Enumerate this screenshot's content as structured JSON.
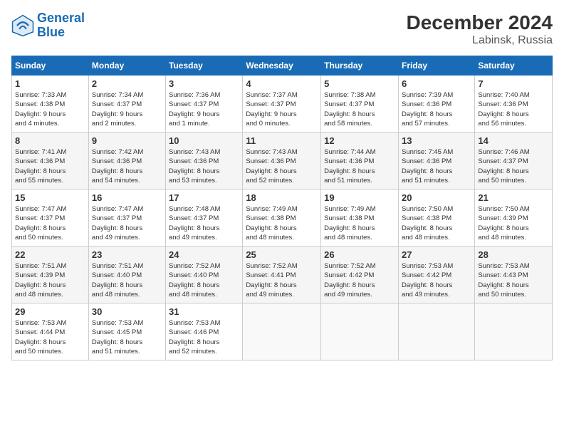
{
  "header": {
    "logo_line1": "General",
    "logo_line2": "Blue",
    "title": "December 2024",
    "subtitle": "Labinsk, Russia"
  },
  "days_of_week": [
    "Sunday",
    "Monday",
    "Tuesday",
    "Wednesday",
    "Thursday",
    "Friday",
    "Saturday"
  ],
  "weeks": [
    [
      {
        "day": "1",
        "info": "Sunrise: 7:33 AM\nSunset: 4:38 PM\nDaylight: 9 hours\nand 4 minutes."
      },
      {
        "day": "2",
        "info": "Sunrise: 7:34 AM\nSunset: 4:37 PM\nDaylight: 9 hours\nand 2 minutes."
      },
      {
        "day": "3",
        "info": "Sunrise: 7:36 AM\nSunset: 4:37 PM\nDaylight: 9 hours\nand 1 minute."
      },
      {
        "day": "4",
        "info": "Sunrise: 7:37 AM\nSunset: 4:37 PM\nDaylight: 9 hours\nand 0 minutes."
      },
      {
        "day": "5",
        "info": "Sunrise: 7:38 AM\nSunset: 4:37 PM\nDaylight: 8 hours\nand 58 minutes."
      },
      {
        "day": "6",
        "info": "Sunrise: 7:39 AM\nSunset: 4:36 PM\nDaylight: 8 hours\nand 57 minutes."
      },
      {
        "day": "7",
        "info": "Sunrise: 7:40 AM\nSunset: 4:36 PM\nDaylight: 8 hours\nand 56 minutes."
      }
    ],
    [
      {
        "day": "8",
        "info": "Sunrise: 7:41 AM\nSunset: 4:36 PM\nDaylight: 8 hours\nand 55 minutes."
      },
      {
        "day": "9",
        "info": "Sunrise: 7:42 AM\nSunset: 4:36 PM\nDaylight: 8 hours\nand 54 minutes."
      },
      {
        "day": "10",
        "info": "Sunrise: 7:43 AM\nSunset: 4:36 PM\nDaylight: 8 hours\nand 53 minutes."
      },
      {
        "day": "11",
        "info": "Sunrise: 7:43 AM\nSunset: 4:36 PM\nDaylight: 8 hours\nand 52 minutes."
      },
      {
        "day": "12",
        "info": "Sunrise: 7:44 AM\nSunset: 4:36 PM\nDaylight: 8 hours\nand 51 minutes."
      },
      {
        "day": "13",
        "info": "Sunrise: 7:45 AM\nSunset: 4:36 PM\nDaylight: 8 hours\nand 51 minutes."
      },
      {
        "day": "14",
        "info": "Sunrise: 7:46 AM\nSunset: 4:37 PM\nDaylight: 8 hours\nand 50 minutes."
      }
    ],
    [
      {
        "day": "15",
        "info": "Sunrise: 7:47 AM\nSunset: 4:37 PM\nDaylight: 8 hours\nand 50 minutes."
      },
      {
        "day": "16",
        "info": "Sunrise: 7:47 AM\nSunset: 4:37 PM\nDaylight: 8 hours\nand 49 minutes."
      },
      {
        "day": "17",
        "info": "Sunrise: 7:48 AM\nSunset: 4:37 PM\nDaylight: 8 hours\nand 49 minutes."
      },
      {
        "day": "18",
        "info": "Sunrise: 7:49 AM\nSunset: 4:38 PM\nDaylight: 8 hours\nand 48 minutes."
      },
      {
        "day": "19",
        "info": "Sunrise: 7:49 AM\nSunset: 4:38 PM\nDaylight: 8 hours\nand 48 minutes."
      },
      {
        "day": "20",
        "info": "Sunrise: 7:50 AM\nSunset: 4:38 PM\nDaylight: 8 hours\nand 48 minutes."
      },
      {
        "day": "21",
        "info": "Sunrise: 7:50 AM\nSunset: 4:39 PM\nDaylight: 8 hours\nand 48 minutes."
      }
    ],
    [
      {
        "day": "22",
        "info": "Sunrise: 7:51 AM\nSunset: 4:39 PM\nDaylight: 8 hours\nand 48 minutes."
      },
      {
        "day": "23",
        "info": "Sunrise: 7:51 AM\nSunset: 4:40 PM\nDaylight: 8 hours\nand 48 minutes."
      },
      {
        "day": "24",
        "info": "Sunrise: 7:52 AM\nSunset: 4:40 PM\nDaylight: 8 hours\nand 48 minutes."
      },
      {
        "day": "25",
        "info": "Sunrise: 7:52 AM\nSunset: 4:41 PM\nDaylight: 8 hours\nand 49 minutes."
      },
      {
        "day": "26",
        "info": "Sunrise: 7:52 AM\nSunset: 4:42 PM\nDaylight: 8 hours\nand 49 minutes."
      },
      {
        "day": "27",
        "info": "Sunrise: 7:53 AM\nSunset: 4:42 PM\nDaylight: 8 hours\nand 49 minutes."
      },
      {
        "day": "28",
        "info": "Sunrise: 7:53 AM\nSunset: 4:43 PM\nDaylight: 8 hours\nand 50 minutes."
      }
    ],
    [
      {
        "day": "29",
        "info": "Sunrise: 7:53 AM\nSunset: 4:44 PM\nDaylight: 8 hours\nand 50 minutes."
      },
      {
        "day": "30",
        "info": "Sunrise: 7:53 AM\nSunset: 4:45 PM\nDaylight: 8 hours\nand 51 minutes."
      },
      {
        "day": "31",
        "info": "Sunrise: 7:53 AM\nSunset: 4:46 PM\nDaylight: 8 hours\nand 52 minutes."
      },
      null,
      null,
      null,
      null
    ]
  ]
}
